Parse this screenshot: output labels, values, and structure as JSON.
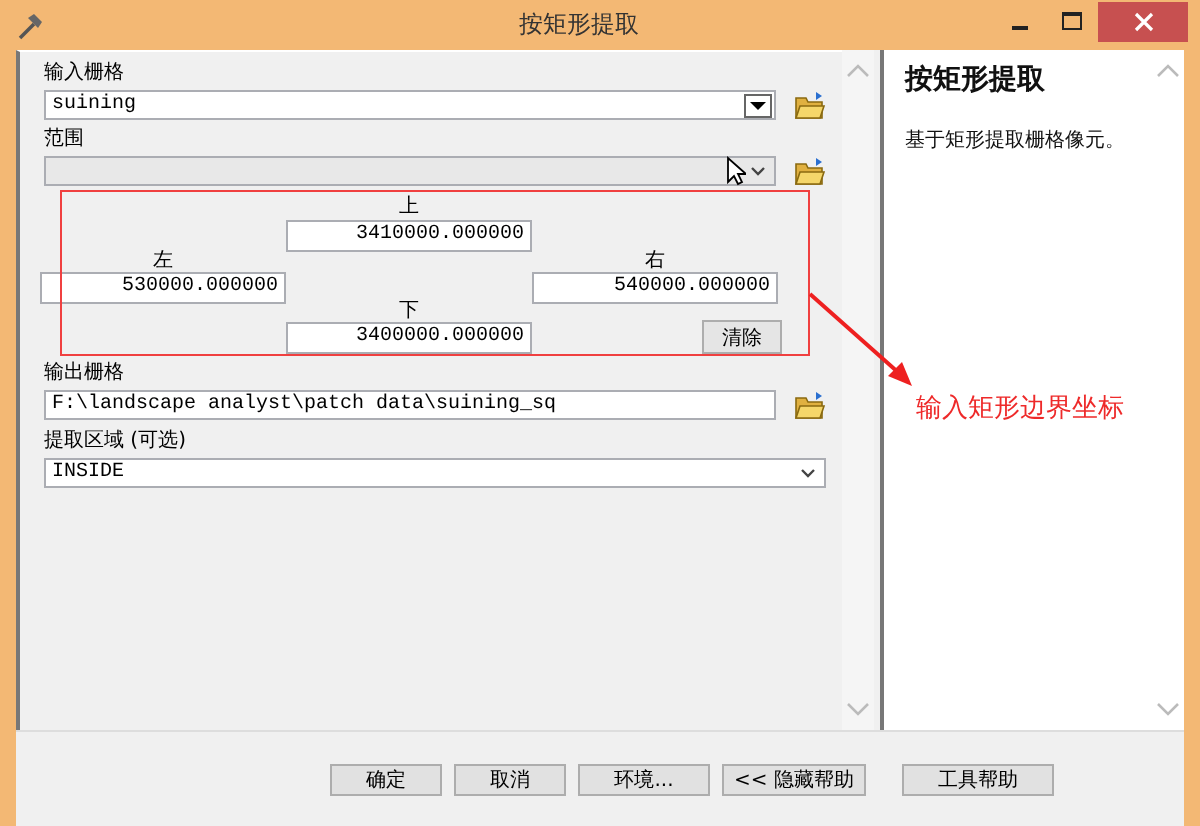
{
  "window": {
    "title": "按矩形提取"
  },
  "input_raster": {
    "label": "输入栅格",
    "value": "suining"
  },
  "extent": {
    "label": "范围",
    "disabled": true,
    "top": {
      "label": "上",
      "value": "3410000.000000"
    },
    "left": {
      "label": "左",
      "value": "530000.000000"
    },
    "right": {
      "label": "右",
      "value": "540000.000000"
    },
    "bottom": {
      "label": "下",
      "value": "3400000.000000"
    },
    "clear_button": "清除"
  },
  "output_raster": {
    "label": "输出栅格",
    "value": "F:\\landscape analyst\\patch data\\suining_sq"
  },
  "extraction_area": {
    "label": "提取区域 (可选)",
    "value": "INSIDE"
  },
  "buttons": [
    "确定",
    "取消",
    "环境...",
    "<< 隐藏帮助",
    "工具帮助"
  ],
  "help": {
    "title": "按矩形提取",
    "text": "基于矩形提取栅格像元。"
  },
  "annotation": {
    "text": "输入矩形边界坐标"
  }
}
